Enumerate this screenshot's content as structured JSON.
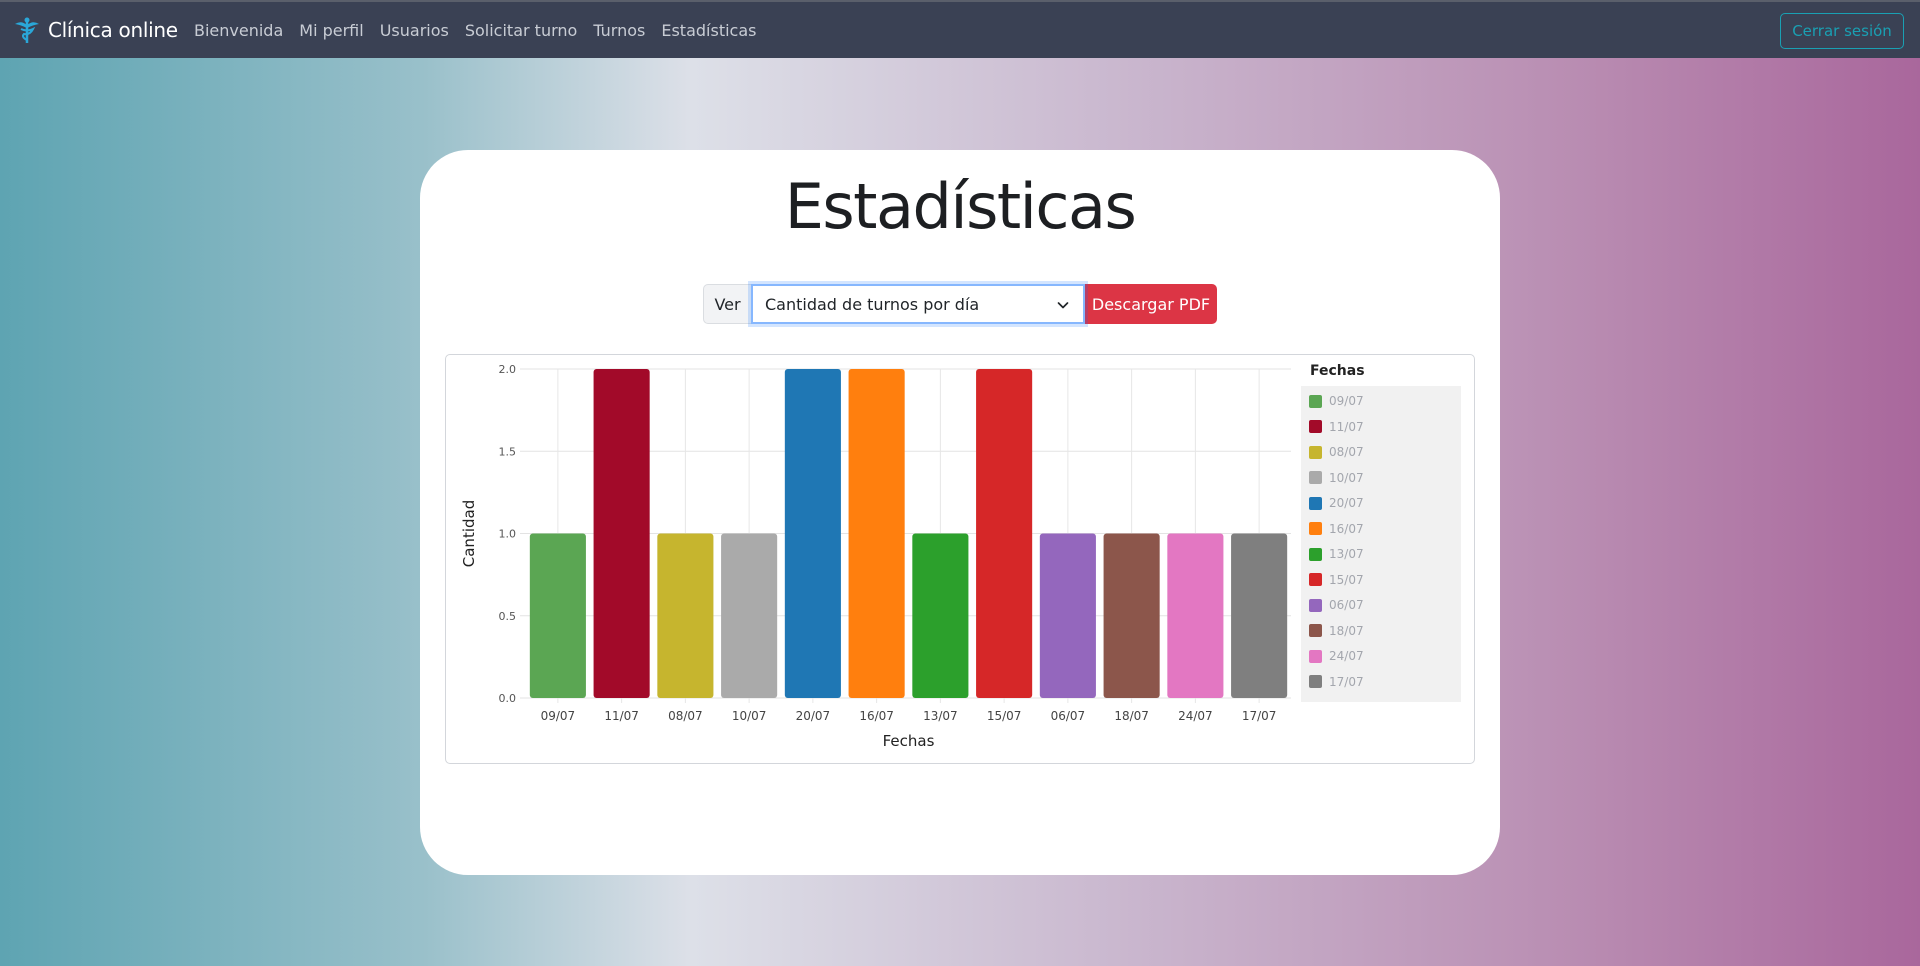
{
  "nav": {
    "brand": "Clínica online",
    "links": [
      "Bienvenida",
      "Mi perfil",
      "Usuarios",
      "Solicitar turno",
      "Turnos",
      "Estadísticas"
    ],
    "logout": "Cerrar sesión"
  },
  "page": {
    "title": "Estadísticas",
    "ver_label": "Ver",
    "select_value": "Cantidad de turnos por día",
    "pdf_button": "Descargar PDF"
  },
  "legend": {
    "title": "Fechas",
    "items": [
      {
        "label": "09/07",
        "color": "#5ba653"
      },
      {
        "label": "11/07",
        "color": "#a20a29"
      },
      {
        "label": "08/07",
        "color": "#c6b52e"
      },
      {
        "label": "10/07",
        "color": "#aaaaaa"
      },
      {
        "label": "20/07",
        "color": "#1f77b4"
      },
      {
        "label": "16/07",
        "color": "#ff7f0e"
      },
      {
        "label": "13/07",
        "color": "#2ca02c"
      },
      {
        "label": "15/07",
        "color": "#d62728"
      },
      {
        "label": "06/07",
        "color": "#9467bd"
      },
      {
        "label": "18/07",
        "color": "#8c564b"
      },
      {
        "label": "24/07",
        "color": "#e377c2"
      },
      {
        "label": "17/07",
        "color": "#7f7f7f"
      }
    ]
  },
  "chart_data": {
    "type": "bar",
    "categories": [
      "09/07",
      "11/07",
      "08/07",
      "10/07",
      "20/07",
      "16/07",
      "13/07",
      "15/07",
      "06/07",
      "18/07",
      "24/07",
      "17/07"
    ],
    "values": [
      1,
      2,
      1,
      1,
      2,
      2,
      1,
      2,
      1,
      1,
      1,
      1
    ],
    "colors": [
      "#5ba653",
      "#a20a29",
      "#c6b52e",
      "#aaaaaa",
      "#1f77b4",
      "#ff7f0e",
      "#2ca02c",
      "#d62728",
      "#9467bd",
      "#8c564b",
      "#e377c2",
      "#7f7f7f"
    ],
    "xlabel": "Fechas",
    "ylabel": "Cantidad",
    "ylim": [
      0,
      2
    ],
    "yticks": [
      "0.0",
      "0.5",
      "1.0",
      "1.5",
      "2.0"
    ],
    "grid": true,
    "legend_position": "right"
  }
}
